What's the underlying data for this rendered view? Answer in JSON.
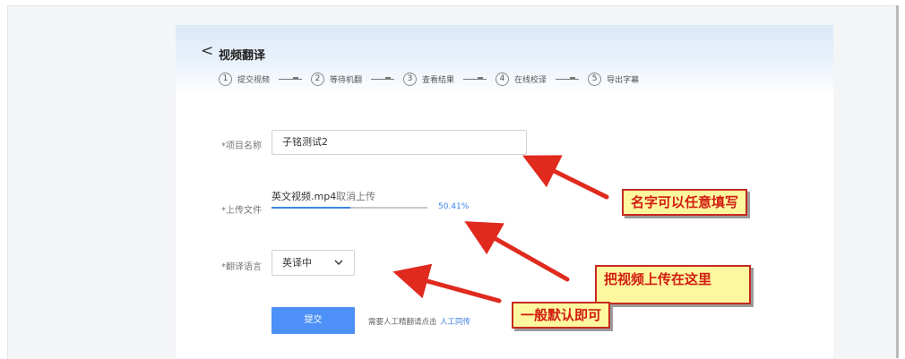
{
  "header": {
    "back_glyph": "<",
    "title": "视频翻译",
    "steps": [
      {
        "num": "1",
        "label": "提交视频"
      },
      {
        "num": "2",
        "label": "等待机翻"
      },
      {
        "num": "3",
        "label": "查看结果"
      },
      {
        "num": "4",
        "label": "在线校译"
      },
      {
        "num": "5",
        "label": "导出字幕"
      }
    ]
  },
  "form": {
    "project_name_label": "*项目名称",
    "project_name_value": "子铭测试2",
    "upload_label": "*上传文件",
    "file_name": "英文视频.mp4",
    "cancel_upload": "取消上传",
    "progress_percent": 50.41,
    "progress_text": "50.41%",
    "language_label": "*翻译语言",
    "language_value": "英译中",
    "submit_label": "提交",
    "hint_text": "需要人工精翻请点击",
    "hint_link": "人工同传"
  },
  "annotations": {
    "name_note": "名字可以任意填写",
    "upload_note": "把视频上传在这里",
    "language_note": "一般默认即可"
  },
  "colors": {
    "accent": "#4d90f7",
    "callout_bg": "#fdf79f",
    "callout_text": "#d11d12",
    "arrow": "#e02a1e"
  },
  "icons": {
    "back": "chevron-left-icon",
    "dropdown": "chevron-down-icon"
  }
}
